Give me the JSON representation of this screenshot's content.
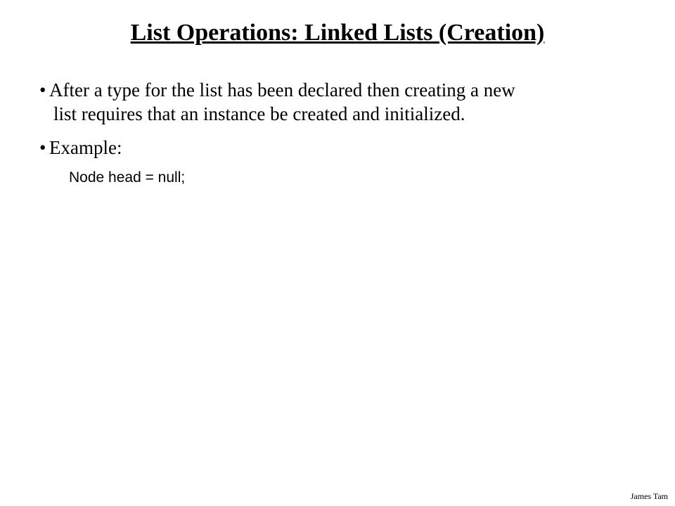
{
  "title": "List Operations: Linked Lists (Creation)",
  "bullets": {
    "b1_line1": "After a type for the list has been declared then creating a new",
    "b1_line2": "list requires that an instance be created and initialized.",
    "b2": "Example:"
  },
  "code": "Node head = null;",
  "footer": "James Tam"
}
